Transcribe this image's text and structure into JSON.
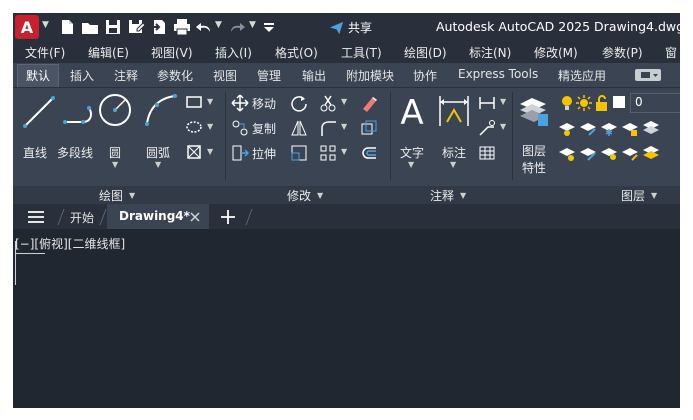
{
  "titlebar": {
    "logo_letter": "A",
    "share_label": "共享",
    "title": "Autodesk AutoCAD 2025    Drawing4.dwg",
    "quick_access_icons": [
      "new-icon",
      "open-icon",
      "save-icon",
      "save-as-icon",
      "export-icon",
      "print-icon",
      "undo-icon",
      "redo-icon",
      "customize-icon"
    ]
  },
  "menubar": {
    "items": [
      "文件(F)",
      "编辑(E)",
      "视图(V)",
      "插入(I)",
      "格式(O)",
      "工具(T)",
      "绘图(D)",
      "标注(N)",
      "修改(M)",
      "参数(P)",
      "窗"
    ]
  },
  "ribbon_tabs": {
    "items": [
      "默认",
      "插入",
      "注释",
      "参数化",
      "视图",
      "管理",
      "输出",
      "附加模块",
      "协作",
      "Express Tools",
      "精选应用"
    ],
    "active_index": 0
  },
  "draw_panel": {
    "line": "直线",
    "polyline": "多段线",
    "circle": "圆",
    "arc": "圆弧",
    "footer": "绘图"
  },
  "modify_panel": {
    "move": "移动",
    "copy": "复制",
    "stretch": "拉伸",
    "footer": "修改"
  },
  "annotation_panel": {
    "text": "文字",
    "dimension": "标注",
    "footer": "注释"
  },
  "layers_panel": {
    "properties_line1": "图层",
    "properties_line2": "特性",
    "current_layer": "0",
    "footer": "图层"
  },
  "filetabs": {
    "start": "开始",
    "active_doc": "Drawing4*"
  },
  "canvas": {
    "viewport_label": "[−][俯视][二维线框]"
  },
  "colors": {
    "logo_red": "#c8202c",
    "accent_blue": "#4aa3df",
    "bulb_yellow": "#f3c500",
    "background": "#212730"
  }
}
